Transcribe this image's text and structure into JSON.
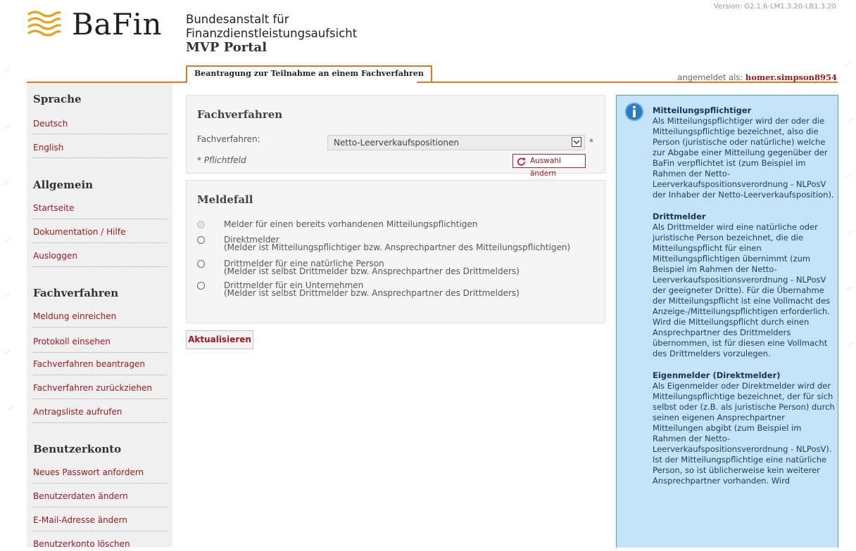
{
  "header": {
    "logo_text": "BaFin",
    "org_line1": "Bundesanstalt für",
    "org_line2": "Finanzdienstleistungsaufsicht",
    "portal": "MVP Portal",
    "version": "Version: G2.1.6-LM1.3.20-LB1.3.20",
    "active_tab": "Beantragung zur Teilnahme an einem Fachverfahren",
    "logged_in_label": "angemeldet als:",
    "username": "homer.simpson8954",
    "accent_color": "#e37722",
    "link_color": "#a5171f"
  },
  "sidebar": {
    "sections": [
      {
        "title": "Sprache",
        "items": [
          "Deutsch",
          "English"
        ]
      },
      {
        "title": "Allgemein",
        "items": [
          "Startseite",
          "Dokumentation / Hilfe",
          "Ausloggen"
        ]
      },
      {
        "title": "Fachverfahren",
        "items": [
          "Meldung einreichen",
          "Protokoll einsehen",
          "Fachverfahren beantragen",
          "Fachverfahren zurückziehen",
          "Antragsliste aufrufen"
        ]
      },
      {
        "title": "Benutzerkonto",
        "items": [
          "Neues Passwort anfordern",
          "Benutzerdaten ändern",
          "E-Mail-Adresse ändern",
          "Benutzerkonto löschen"
        ]
      }
    ]
  },
  "fachverfahren_box": {
    "title": "Fachverfahren",
    "field_label": "Fachverfahren:",
    "selected_value": "Netto-Leerverkaufspositionen",
    "required_marker": "*",
    "required_note": "* Pflichtfeld",
    "change_button": "Auswahl ändern"
  },
  "meldefall_box": {
    "title": "Meldefall",
    "options": [
      {
        "line1": "Melder für einen bereits vorhandenen Mitteilungspflichtigen",
        "line2": "",
        "disabled": true
      },
      {
        "line1": "Direktmelder",
        "line2": "(Melder ist Mitteilungspflichtiger bzw. Ansprechpartner des Mitteilungspflichtigen)",
        "disabled": false
      },
      {
        "line1": "Drittmelder für eine natürliche Person",
        "line2": "(Melder ist selbst Drittmelder bzw. Ansprechpartner des Drittmelders)",
        "disabled": false
      },
      {
        "line1": "Drittmelder für ein Unternehmen",
        "line2": "(Melder ist selbst Drittmelder bzw. Ansprechpartner des Drittmelders)",
        "disabled": false
      }
    ]
  },
  "update_button": "Aktualisieren",
  "info_panel": {
    "icon": "info-icon",
    "blocks": [
      {
        "heading": "Mitteilungspflichtiger",
        "text": "Als Mitteilungspflichtiger wird der oder die Mitteilungspflichtige bezeichnet, also die Person (juristische oder natürliche) welche zur Abgabe einer Mitteilung gegenüber der BaFin verpflichtet ist (zum Beispiel im Rahmen der Netto-Leerverkaufspositionsverordnung - NLPosV der Inhaber der Netto-Leerverkaufsposition)."
      },
      {
        "heading": "Drittmelder",
        "text": "Als Drittmelder wird eine natürliche oder juristische Person bezeichnet, die die Mitteilungspflicht für einen Mitteilungspflichtigen übernimmt (zum Beispiel im Rahmen der Netto-Leerverkaufspositionsverordnung - NLPosV der geeigneter Dritte). Für die Übernahme der Mitteilungspflicht ist eine Vollmacht des Anzeige-/Mitteilungspflichtigen erforderlich. Wird die Mitteilungspflicht durch einen Ansprechpartner des Drittmelders übernommen, ist für diesen eine Vollmacht des Drittmelders vorzulegen."
      },
      {
        "heading": "Eigenmelder (Direktmelder)",
        "text": "Als Eigenmelder oder Direktmelder wird der Mitteilungspflichtige bezeichnet, der für sich selbst oder (z.B. als juristische Person) durch seinen eigenen Ansprechpartner Mitteilungen abgibt (zum Beispiel im Rahmen der Netto-Leerverkaufspositionsverordnung - NLPosV). Ist der Mitteilungspflichtige eine natürliche Person, so ist üblicherweise kein weiterer Ansprechpartner vorhanden. Wird"
      }
    ]
  }
}
